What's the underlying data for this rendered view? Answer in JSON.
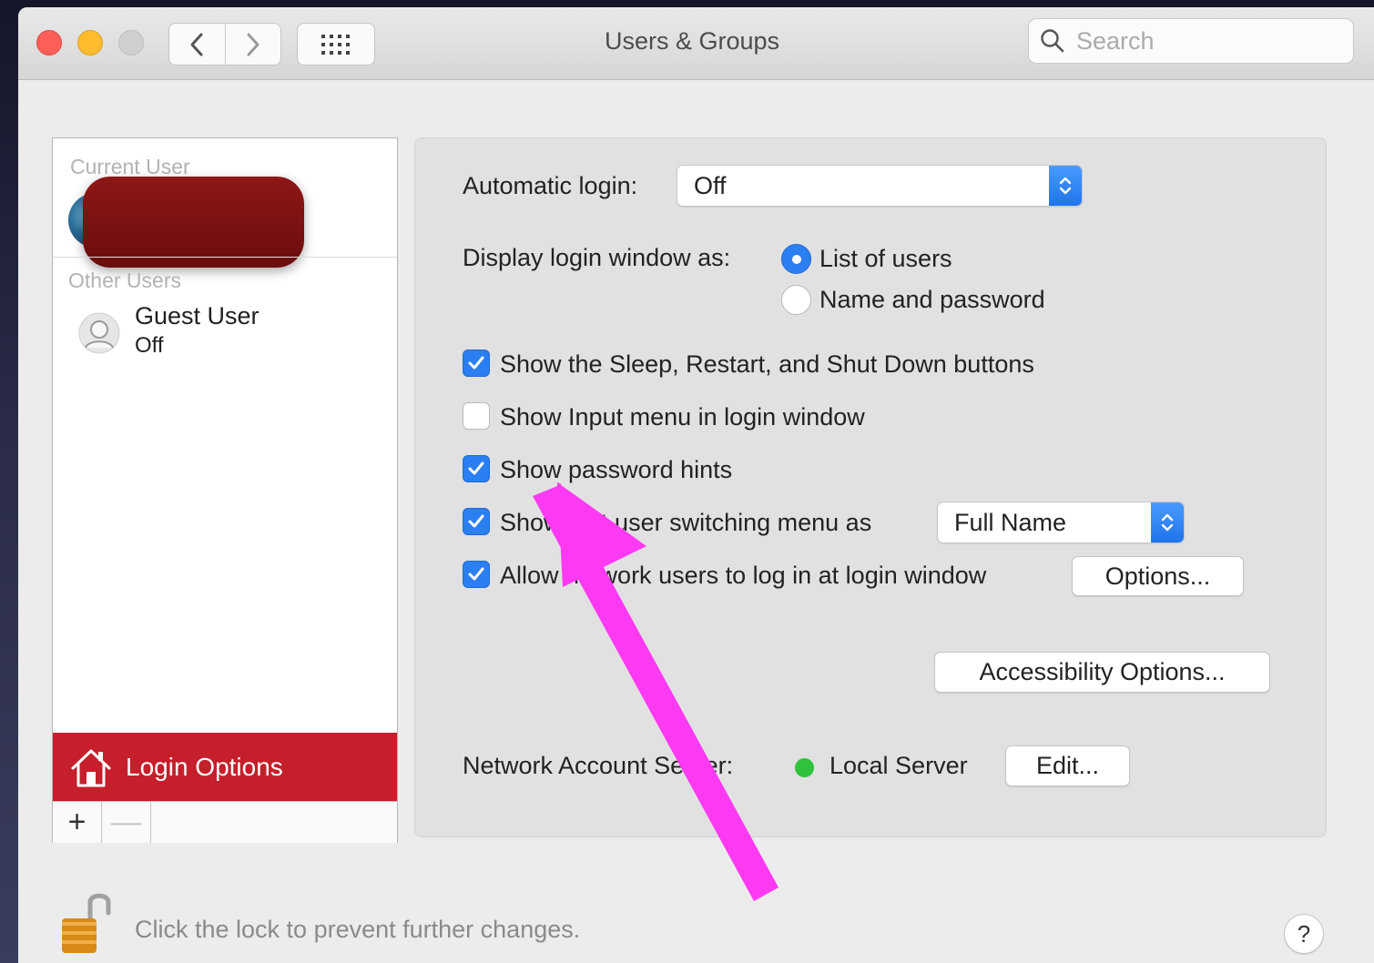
{
  "window": {
    "title": "Users & Groups",
    "search_placeholder": "Search"
  },
  "icons": {
    "back": "chevron-left-icon",
    "forward": "chevron-right-icon",
    "show_all": "grid-icon",
    "search": "search-icon",
    "home": "house-icon",
    "lock": "lock-open-icon",
    "annotation": "pink-arrow"
  },
  "sidebar": {
    "current_user_label": "Current User",
    "other_users_label": "Other Users",
    "guest_user": {
      "name": "Guest User",
      "status": "Off"
    },
    "login_options_label": "Login Options",
    "add_symbol": "+",
    "remove_symbol": "—"
  },
  "login_options": {
    "automatic_login_label": "Automatic login:",
    "automatic_login_value": "Off",
    "display_login_window_label": "Display login window as:",
    "display_options": [
      {
        "label": "List of users",
        "selected": true
      },
      {
        "label": "Name and password",
        "selected": false
      }
    ],
    "checkboxes": [
      {
        "label": "Show the Sleep, Restart, and Shut Down buttons",
        "checked": true
      },
      {
        "label": "Show Input menu in login window",
        "checked": false
      },
      {
        "label": "Show password hints",
        "checked": true
      },
      {
        "label": "Show fast user switching menu as",
        "checked": true
      },
      {
        "label": "Allow network users to log in at login window",
        "checked": true
      }
    ],
    "user_switching_value": "Full Name",
    "options_button": "Options...",
    "accessibility_button": "Accessibility Options...",
    "network_server_label": "Network Account Server:",
    "network_server_value": "Local Server",
    "edit_button": "Edit..."
  },
  "footer": {
    "lock_text": "Click the lock to prevent further changes.",
    "help_symbol": "?"
  },
  "colors": {
    "accent_blue": "#2b7ff2",
    "login_options_red": "#c41f2b",
    "status_green": "#2fc23a",
    "annotation_pink": "#ff3af2"
  }
}
